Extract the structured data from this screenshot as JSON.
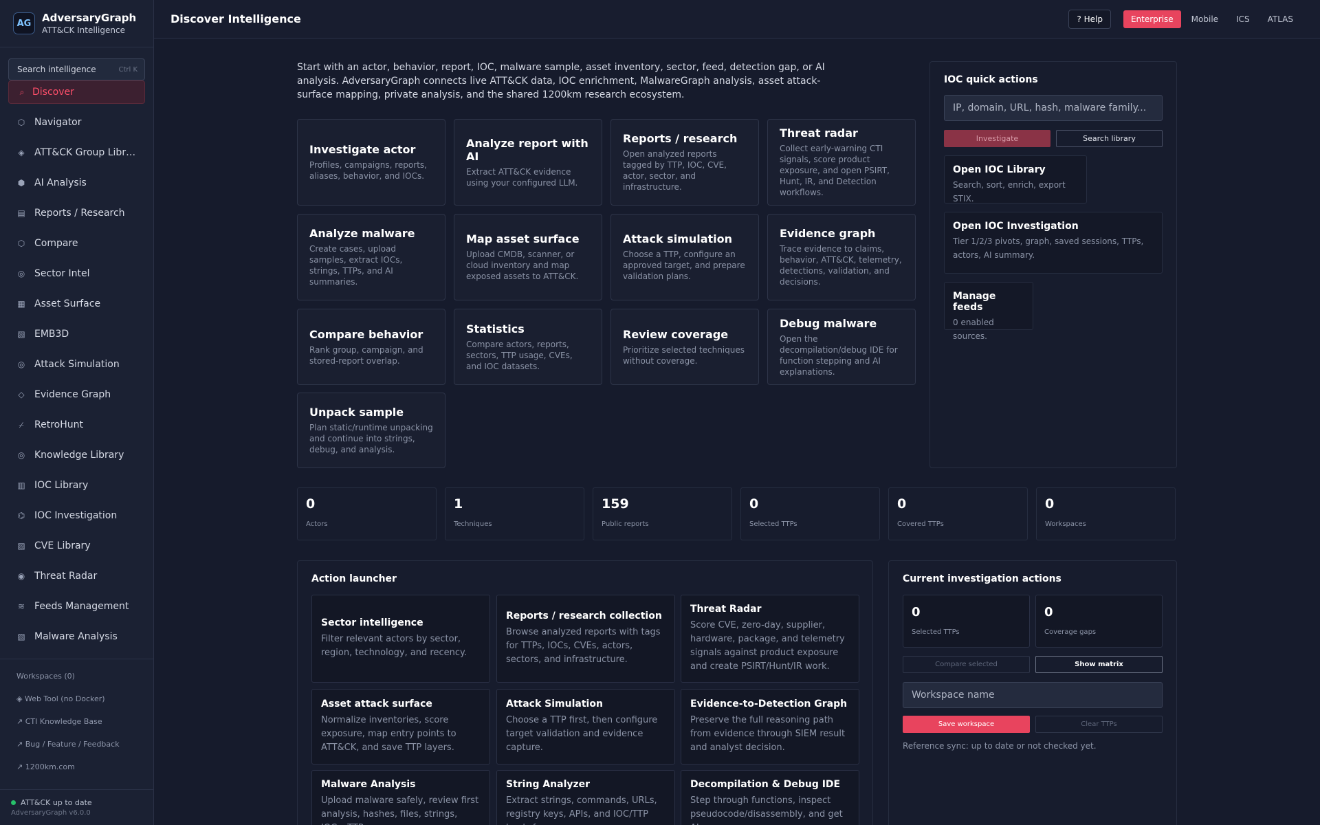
{
  "brand": {
    "title": "AdversaryGraph",
    "subtitle": "ATT&CK Intelligence",
    "logo_text": "AG"
  },
  "search": {
    "placeholder": "Search intelligence",
    "shortcut": "Ctrl K"
  },
  "nav": [
    {
      "label": "Discover",
      "icon": "search-icon",
      "glyph": "⌕",
      "active": true
    },
    {
      "label": "Navigator",
      "icon": "hexagon-icon",
      "glyph": "⬡"
    },
    {
      "label": "ATT&CK Group Libr…",
      "icon": "diamond-icon",
      "glyph": "◈"
    },
    {
      "label": "AI Analysis",
      "icon": "hexagon-filled-icon",
      "glyph": "⬢"
    },
    {
      "label": "Reports / Research",
      "icon": "document-icon",
      "glyph": "▤"
    },
    {
      "label": "Compare",
      "icon": "hexagon-icon",
      "glyph": "⬡"
    },
    {
      "label": "Sector Intel",
      "icon": "target-icon",
      "glyph": "◎"
    },
    {
      "label": "Asset Surface",
      "icon": "grid-icon",
      "glyph": "▦"
    },
    {
      "label": "EMB3D",
      "icon": "hatched-square-icon",
      "glyph": "▧"
    },
    {
      "label": "Attack Simulation",
      "icon": "target-icon",
      "glyph": "◎"
    },
    {
      "label": "Evidence Graph",
      "icon": "diamond-outline-icon",
      "glyph": "◇"
    },
    {
      "label": "RetroHunt",
      "icon": "split-icon",
      "glyph": "⌿"
    },
    {
      "label": "Knowledge Library",
      "icon": "target-icon",
      "glyph": "◎"
    },
    {
      "label": "IOC Library",
      "icon": "grid-icon",
      "glyph": "▥"
    },
    {
      "label": "IOC Investigation",
      "icon": "hexagon-icon",
      "glyph": "⌬"
    },
    {
      "label": "CVE Library",
      "icon": "hatched-square-icon",
      "glyph": "▨"
    },
    {
      "label": "Threat Radar",
      "icon": "radar-icon",
      "glyph": "◉"
    },
    {
      "label": "Feeds Management",
      "icon": "feed-icon",
      "glyph": "≋"
    },
    {
      "label": "Malware Analysis",
      "icon": "hatched-square-icon",
      "glyph": "▧"
    }
  ],
  "side_links": [
    "Workspaces (0)",
    "◈ Web Tool (no Docker)",
    "↗ CTI Knowledge Base",
    "↗ Bug / Feature / Feedback",
    "↗ 1200km.com"
  ],
  "status": {
    "text": "ATT&CK up to date",
    "version": "AdversaryGraph v6.0.0",
    "color": "#27c06a"
  },
  "header": {
    "title": "Discover Intelligence",
    "help": "? Help",
    "platforms": [
      "Enterprise",
      "Mobile",
      "ICS",
      "ATLAS"
    ],
    "active_platform": "Enterprise"
  },
  "intro": "Start with an actor, behavior, report, IOC, malware sample, asset inventory, sector, feed, detection gap, or AI analysis. AdversaryGraph connects live ATT&CK data, IOC enrichment, MalwareGraph analysis, asset attack-surface mapping, private analysis, and the shared 1200km research ecosystem.",
  "cards": [
    {
      "title": "Investigate actor",
      "desc": "Profiles, campaigns, reports, aliases, behavior, and IOCs."
    },
    {
      "title": "Analyze report with AI",
      "desc": "Extract ATT&CK evidence using your configured LLM."
    },
    {
      "title": "Reports / research",
      "desc": "Open analyzed reports tagged by TTP, IOC, CVE, actor, sector, and infrastructure."
    },
    {
      "title": "Threat radar",
      "desc": "Collect early-warning CTI signals, score product exposure, and open PSIRT, Hunt, IR, and Detection workflows."
    },
    {
      "title": "Analyze malware",
      "desc": "Create cases, upload samples, extract IOCs, strings, TTPs, and AI summaries."
    },
    {
      "title": "Map asset surface",
      "desc": "Upload CMDB, scanner, or cloud inventory and map exposed assets to ATT&CK."
    },
    {
      "title": "Attack simulation",
      "desc": "Choose a TTP, configure an approved target, and prepare validation plans."
    },
    {
      "title": "Evidence graph",
      "desc": "Trace evidence to claims, behavior, ATT&CK, telemetry, detections, validation, and decisions."
    },
    {
      "title": "Compare behavior",
      "desc": "Rank group, campaign, and stored-report overlap."
    },
    {
      "title": "Statistics",
      "desc": "Compare actors, reports, sectors, TTP usage, CVEs, and IOC datasets."
    },
    {
      "title": "Review coverage",
      "desc": "Prioritize selected techniques without coverage."
    },
    {
      "title": "Debug malware",
      "desc": "Open the decompilation/debug IDE for function stepping and AI explanations."
    },
    {
      "title": "Unpack sample",
      "desc": "Plan static/runtime unpacking and continue into strings, debug, and analysis."
    }
  ],
  "ioc": {
    "title": "IOC quick actions",
    "placeholder": "IP, domain, URL, hash, malware family...",
    "investigate": "Investigate",
    "search_library": "Search library",
    "links": [
      {
        "title": "Open IOC Library",
        "desc": "Search, sort, enrich, export STIX."
      },
      {
        "title": "Open IOC Investigation",
        "desc": "Tier 1/2/3 pivots, graph, saved sessions, TTPs, actors, AI summary."
      },
      {
        "title": "Manage feeds",
        "desc": "0 enabled sources."
      }
    ]
  },
  "stats": [
    {
      "value": "0",
      "label": "Actors"
    },
    {
      "value": "1",
      "label": "Techniques"
    },
    {
      "value": "159",
      "label": "Public reports"
    },
    {
      "value": "0",
      "label": "Selected TTPs"
    },
    {
      "value": "0",
      "label": "Covered TTPs"
    },
    {
      "value": "0",
      "label": "Workspaces"
    }
  ],
  "launcher": {
    "title": "Action launcher",
    "items": [
      {
        "title": "Sector intelligence",
        "desc": "Filter relevant actors by sector, region, technology, and recency."
      },
      {
        "title": "Reports / research collection",
        "desc": "Browse analyzed reports with tags for TTPs, IOCs, CVEs, actors, sectors, and infrastructure."
      },
      {
        "title": "Threat Radar",
        "desc": "Score CVE, zero-day, supplier, hardware, package, and telemetry signals against product exposure and create PSIRT/Hunt/IR work."
      },
      {
        "title": "Asset attack surface",
        "desc": "Normalize inventories, score exposure, map entry points to ATT&CK, and save TTP layers."
      },
      {
        "title": "Attack Simulation",
        "desc": "Choose a TTP first, then configure target validation and evidence capture."
      },
      {
        "title": "Evidence-to-Detection Graph",
        "desc": "Preserve the full reasoning path from evidence through SIEM result and analyst decision."
      },
      {
        "title": "Malware Analysis",
        "desc": "Upload malware safely, review first analysis, hashes, files, strings, IOCs, TTPs,"
      },
      {
        "title": "String Analyzer",
        "desc": "Extract strings, commands, URLs, registry keys, APIs, and IOC/TTP leads from"
      },
      {
        "title": "Decompilation & Debug IDE",
        "desc": "Step through functions, inspect pseudocode/disassembly, and get AI"
      }
    ]
  },
  "current": {
    "title": "Current investigation actions",
    "stats": [
      {
        "value": "0",
        "label": "Selected TTPs"
      },
      {
        "value": "0",
        "label": "Coverage gaps"
      }
    ],
    "compare": "Compare selected",
    "show_matrix": "Show matrix",
    "workspace_placeholder": "Workspace name",
    "save": "Save workspace",
    "clear": "Clear TTPs",
    "sync": "Reference sync: up to date or not checked yet."
  },
  "colors": {
    "accent": "#e8445e",
    "background": "#161b2c",
    "panel": "#171c2d"
  }
}
